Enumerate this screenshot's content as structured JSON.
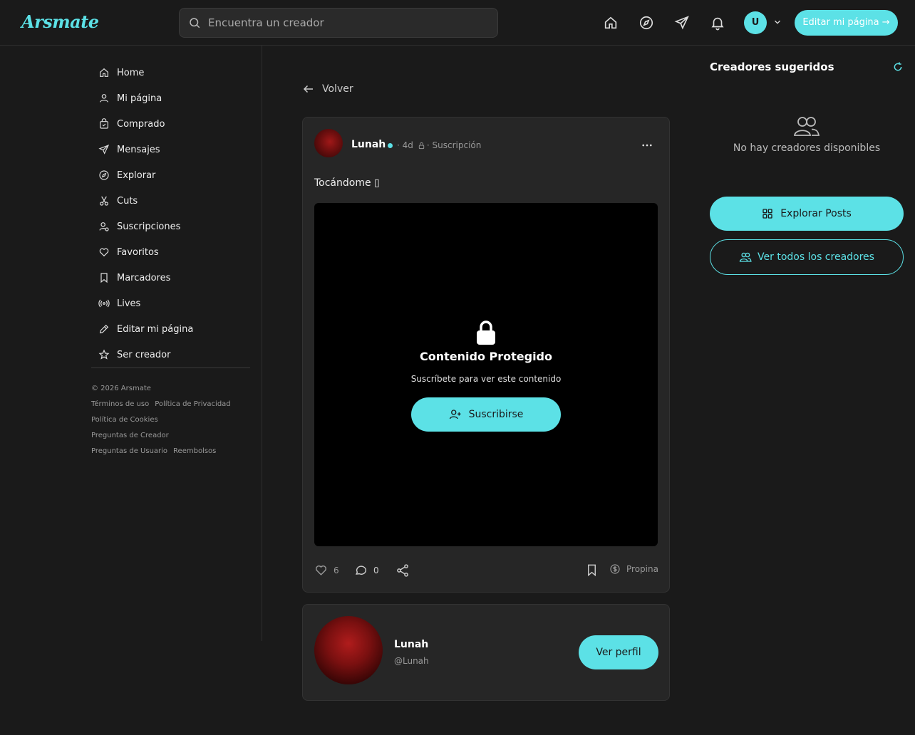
{
  "app": {
    "logo": "Arsmate"
  },
  "search": {
    "placeholder": "Encuentra un creador"
  },
  "topbar": {
    "avatar_initial": "U",
    "edit_label": "Editar mi página →"
  },
  "sidebar": {
    "items": [
      {
        "label": "Home",
        "icon": "home-icon"
      },
      {
        "label": "Mi página",
        "icon": "user-icon"
      },
      {
        "label": "Comprado",
        "icon": "shopping-bag-icon"
      },
      {
        "label": "Mensajes",
        "icon": "send-icon"
      },
      {
        "label": "Explorar",
        "icon": "compass-icon"
      },
      {
        "label": "Cuts",
        "icon": "scissors-icon"
      },
      {
        "label": "Suscripciones",
        "icon": "user-check-icon"
      },
      {
        "label": "Favoritos",
        "icon": "heart-icon"
      },
      {
        "label": "Marcadores",
        "icon": "bookmark-icon"
      },
      {
        "label": "Lives",
        "icon": "broadcast-icon"
      },
      {
        "label": "Editar mi página",
        "icon": "pencil-icon"
      },
      {
        "label": "Ser creador",
        "icon": "star-icon"
      }
    ],
    "footer": {
      "copyright": "© 2026 Arsmate",
      "terms": "Términos de uso",
      "privacy": "Política de Privacidad",
      "cookies": "Política de Cookies",
      "creator_faq": "Preguntas de Creador",
      "user_faq": "Preguntas de Usuario",
      "refunds": "Reembolsos"
    }
  },
  "main": {
    "back_label": "Volver",
    "post": {
      "author": "Lunah",
      "age": "· 4d",
      "visibility": "· Suscripción",
      "text": "Tocándome ▯",
      "locked_title": "Contenido Protegido",
      "locked_subtitle": "Suscríbete para ver este contenido",
      "subscribe_label": "Suscribirse",
      "likes": "6",
      "comments": "0",
      "tip_label": "Propina"
    },
    "profile": {
      "name": "Lunah",
      "handle": "@Lunah",
      "view_label": "Ver perfil"
    }
  },
  "right": {
    "title": "Creadores sugeridos",
    "empty": "No hay creadores disponibles",
    "explore_label": "Explorar Posts",
    "all_label": "Ver todos los creadores"
  },
  "colors": {
    "accent": "#5ce1e6",
    "bg": "#1a1a1a",
    "card": "#262626"
  }
}
